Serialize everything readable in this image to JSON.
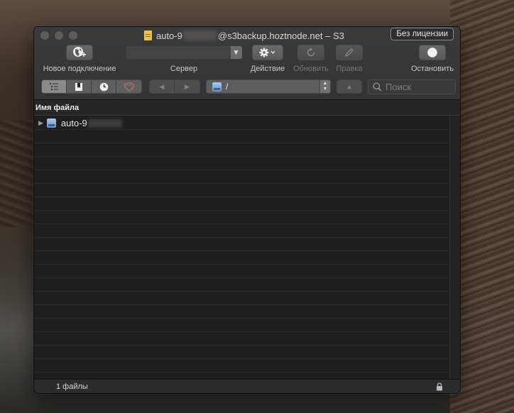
{
  "window": {
    "title_prefix": "auto-9",
    "title_suffix": "@s3backup.hoztnode.net – S3",
    "license_button": "Без лицензии"
  },
  "toolbar": {
    "new_connection": "Новое подключение",
    "server": "Сервер",
    "server_value": "",
    "action": "Действие",
    "refresh": "Обновить",
    "edit": "Правка",
    "stop": "Остановить"
  },
  "navigation": {
    "path": "/",
    "search_placeholder": "Поиск"
  },
  "file_list": {
    "column_name": "Имя файла",
    "rows": [
      {
        "name": "auto-9",
        "type": "bucket",
        "expanded": false
      }
    ]
  },
  "status": {
    "file_count": "1 файлы"
  },
  "icons": [
    "globe-plus-icon",
    "gear-icon",
    "refresh-icon",
    "pencil-icon",
    "stop-icon",
    "outline-view-icon",
    "bookmarks-icon",
    "history-icon",
    "bonjour-icon",
    "back-arrow-icon",
    "forward-arrow-icon",
    "disk-icon",
    "up-arrow-icon",
    "search-icon",
    "lock-icon",
    "document-icon"
  ]
}
